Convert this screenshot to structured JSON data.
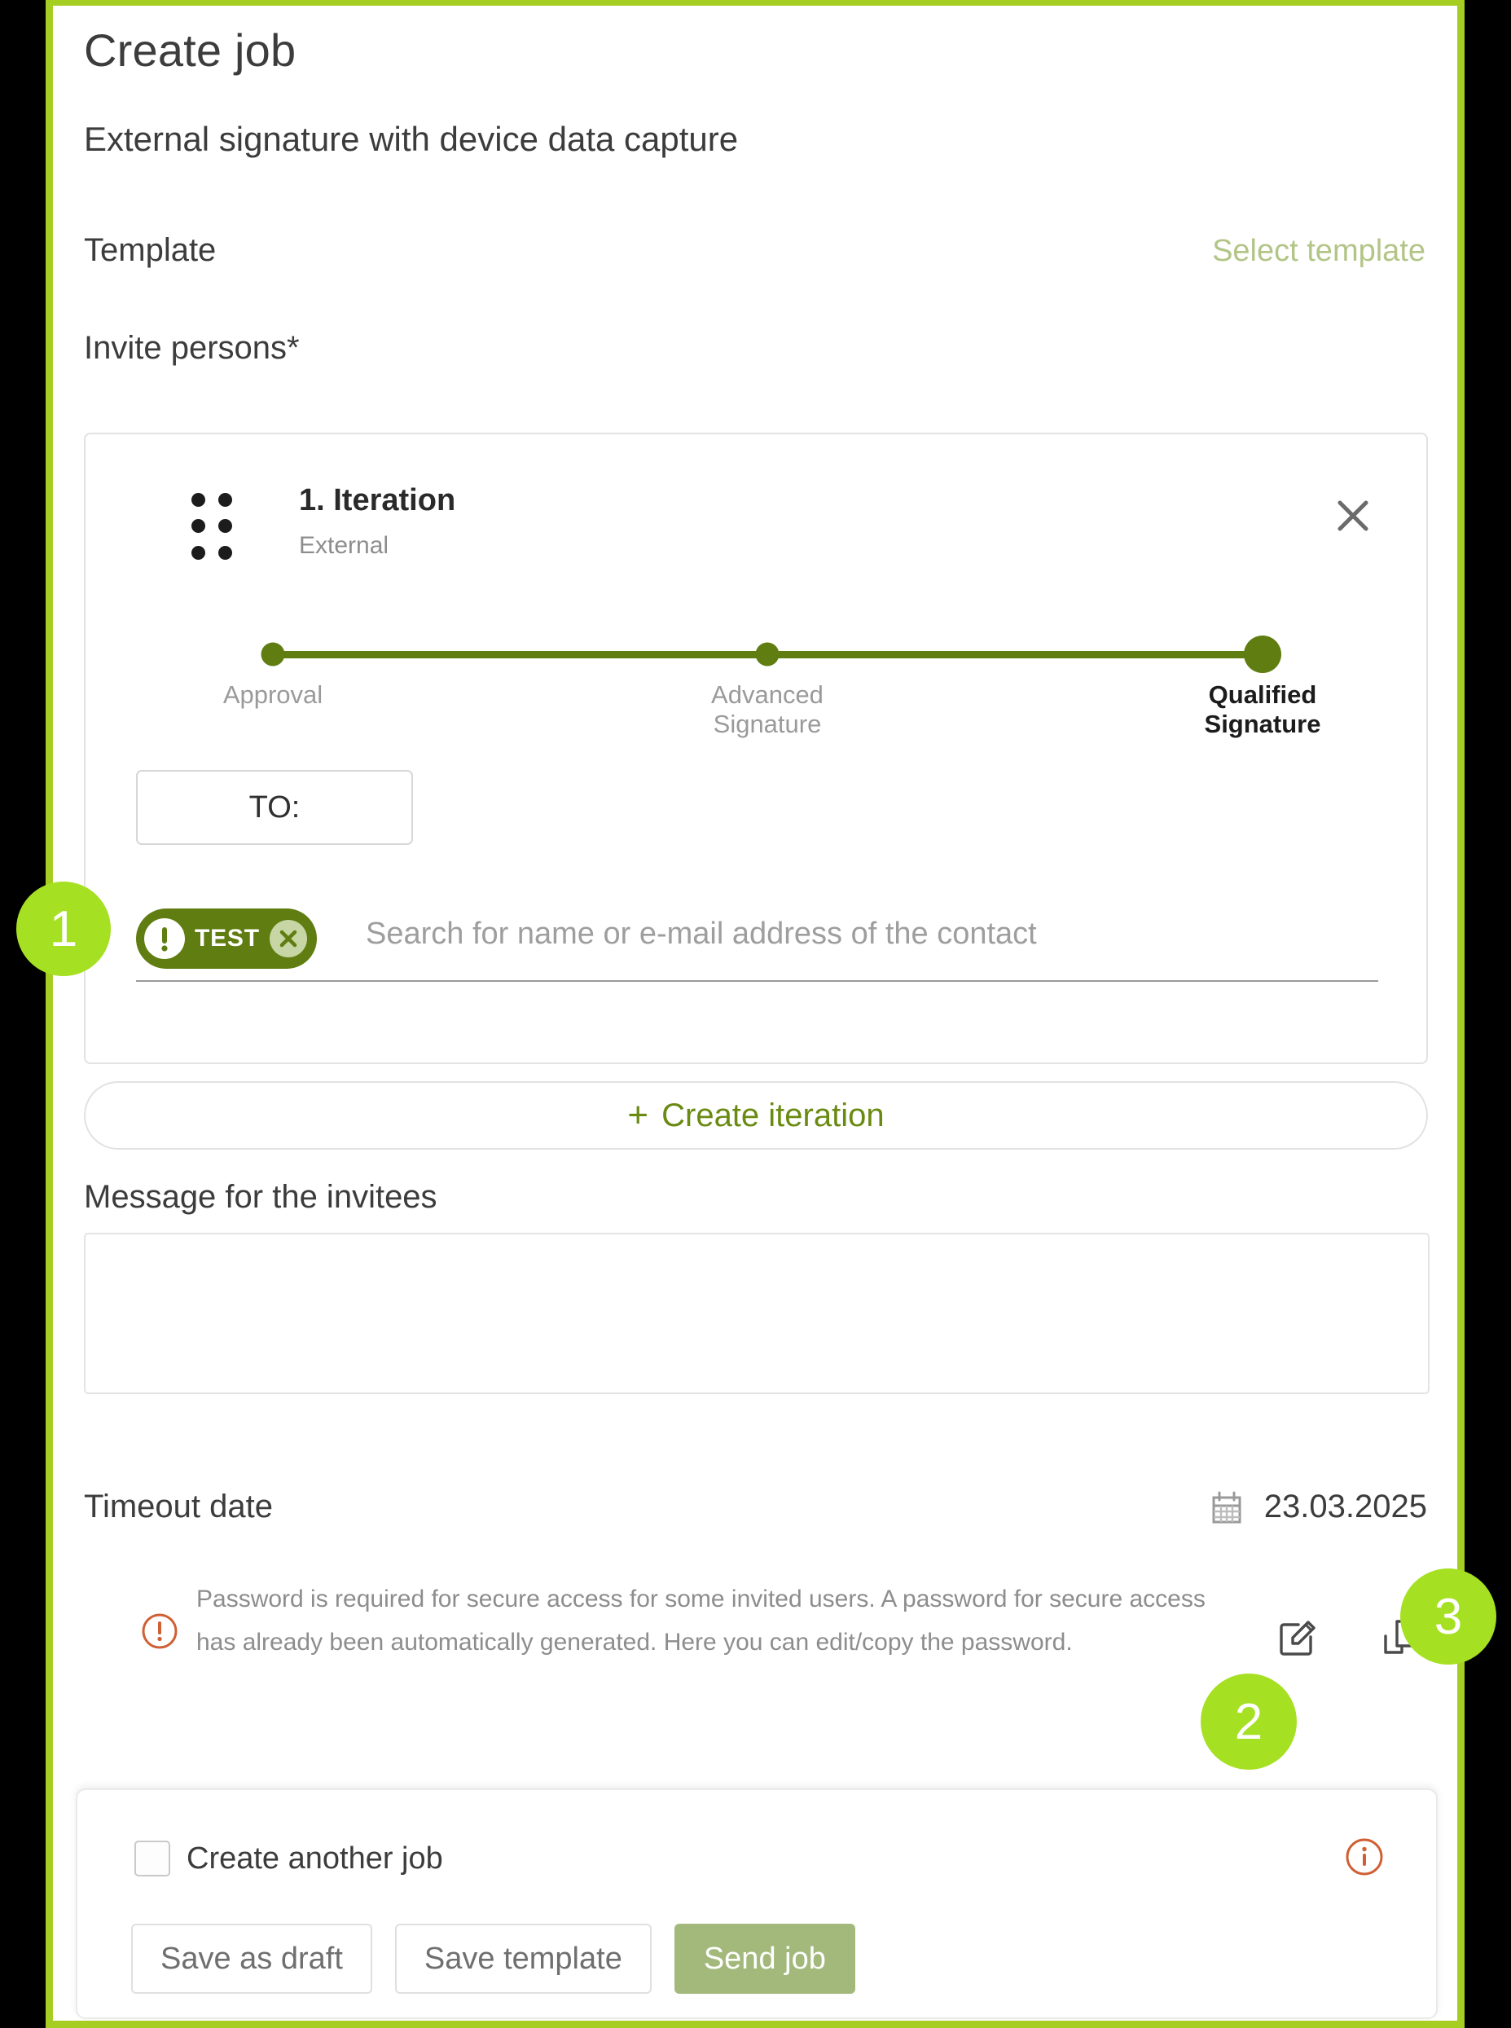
{
  "window": {
    "frame_color": "#a6ce22",
    "background_color": "#000000"
  },
  "header": {
    "title": "Create job",
    "subtitle": "External signature with device data capture"
  },
  "template_row": {
    "label": "Template",
    "action_label": "Select template",
    "action_color": "#b2c587"
  },
  "invite": {
    "section_label": "Invite persons*",
    "iteration": {
      "title": "1. Iteration",
      "subtitle": "External",
      "drag_handle_icon": "drag-dots-icon",
      "close_icon": "close-icon",
      "stepper": {
        "steps": [
          {
            "label": "Approval",
            "selected": false
          },
          {
            "label": "Advanced Signature",
            "selected": false
          },
          {
            "label": "Qualified Signature",
            "selected": true
          }
        ],
        "track_color": "#5f7d10"
      },
      "to_button": "TO:",
      "recipients": [
        {
          "label": "TEST",
          "warning_icon": "exclamation-circle-icon",
          "remove_icon": "close-circle-icon",
          "chip_color": "#5f7d10"
        }
      ],
      "search_placeholder": "Search for name or e-mail address of the contact"
    },
    "create_iteration_label": "Create iteration",
    "create_iteration_icon": "plus-icon"
  },
  "message": {
    "label": "Message for the invitees",
    "value": "",
    "placeholder": ""
  },
  "timeout": {
    "label": "Timeout date",
    "calendar_icon": "calendar-icon",
    "date": "23.03.2025"
  },
  "password_notice": {
    "icon": "exclamation-circle-icon",
    "text": "Password is required for secure access for some invited users. A password for secure access has already been automatically generated. Here you can edit/copy the password.",
    "icon_color": "#cf6034",
    "actions": [
      {
        "name": "edit-password",
        "icon": "edit-square-icon"
      },
      {
        "name": "copy-password",
        "icon": "copy-icon"
      }
    ]
  },
  "footer": {
    "checkbox_label": "Create another job",
    "checkbox_checked": false,
    "info_icon": "info-circle-icon",
    "buttons": [
      {
        "label": "Save as draft",
        "style": "ghost"
      },
      {
        "label": "Save template",
        "style": "ghost"
      },
      {
        "label": "Send job",
        "style": "primary"
      }
    ],
    "primary_color": "#a3b97c"
  },
  "annotations": [
    {
      "number": "1",
      "target": "recipient-chip"
    },
    {
      "number": "2",
      "target": "edit-password-button"
    },
    {
      "number": "3",
      "target": "copy-password-button"
    }
  ]
}
